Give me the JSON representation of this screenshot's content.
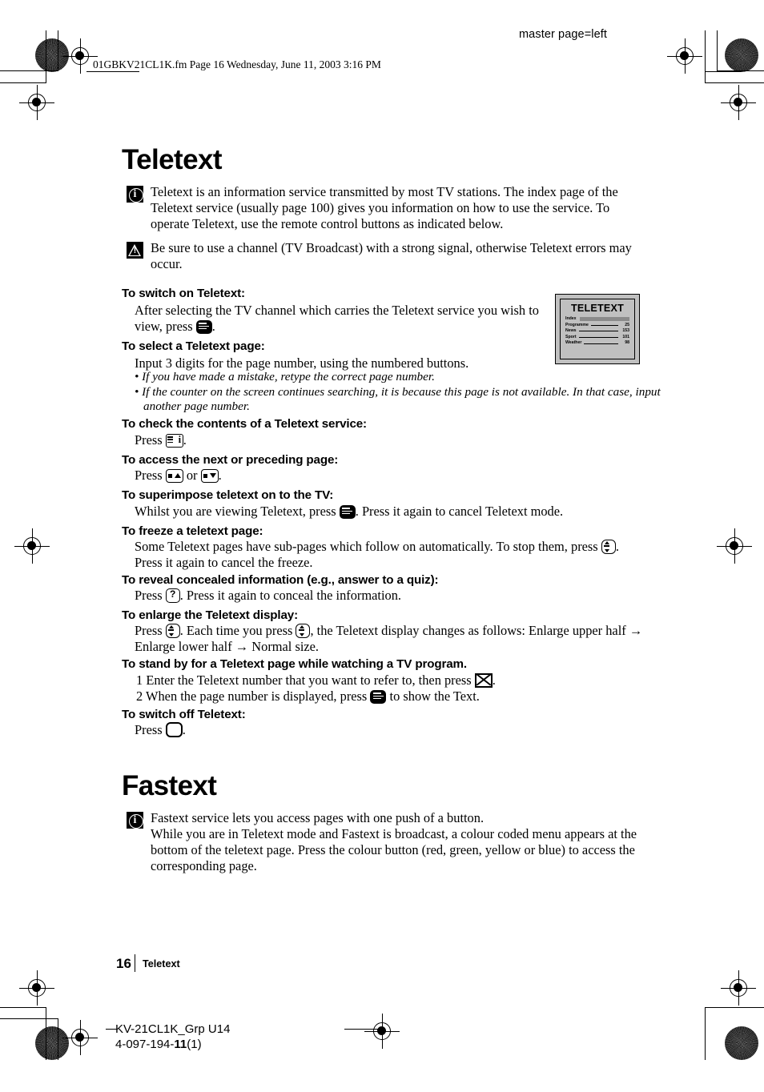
{
  "header": {
    "master_page": "master page=left",
    "filename_line": "01GBKV21CL1K.fm  Page 16  Wednesday, June 11, 2003  3:16 PM"
  },
  "teletext": {
    "title": "Teletext",
    "info_note": "Teletext is an information service transmitted by most TV stations. The index page of the Teletext service (usually page 100) gives you information on how to use the service. To operate Teletext, use the remote control buttons as indicated below.",
    "warning_note": "Be sure to use a channel (TV Broadcast) with a strong signal, otherwise Teletext errors may occur.",
    "sections": {
      "switch_on": {
        "heading": "To switch on Teletext:",
        "body_before": "After selecting the TV channel which carries the Teletext service you wish to view, press",
        "body_after": "."
      },
      "select_page": {
        "heading": "To select a Teletext page:",
        "body": "Input 3 digits for the page number, using the numbered buttons.",
        "bullet1": "If you have made a mistake, retype the correct page number.",
        "bullet2": "If the counter on the screen continues searching, it is because this page is not available. In that case, input another page number."
      },
      "check_contents": {
        "heading": "To check the contents of a Teletext service:",
        "body_before": "Press",
        "body_after": "."
      },
      "next_preceding": {
        "heading": "To access the next or preceding page:",
        "body_before": "Press",
        "body_mid": "or",
        "body_after": "."
      },
      "superimpose": {
        "heading": "To superimpose teletext on to the TV:",
        "body_before": "Whilst you are viewing Teletext, press",
        "body_after": ". Press it again to cancel Teletext mode."
      },
      "freeze": {
        "heading": "To freeze a teletext page:",
        "body_before": "Some Teletext pages have sub-pages which follow on automatically. To stop them, press",
        "body_after": ". Press it again to cancel the freeze."
      },
      "reveal": {
        "heading": "To reveal concealed information (e.g., answer to a quiz):",
        "body_before": "Press",
        "body_after": ". Press it again to conceal the information."
      },
      "enlarge": {
        "heading": "To enlarge the Teletext display:",
        "body_before": "Press",
        "body_mid": ". Each time you press",
        "body_after": ", the Teletext display changes as follows: Enlarge upper half",
        "body_line2_a": "Enlarge lower half",
        "body_line2_b": "Normal size.",
        "arrow": "→"
      },
      "standby": {
        "heading": "To stand by for a Teletext page while watching a TV program.",
        "step1_num": "1",
        "step1_before": "Enter the Teletext number that you want to refer to, then press",
        "step1_after": ".",
        "step2_num": "2",
        "step2_before": "When the page number is displayed, press",
        "step2_after": "to show the Text."
      },
      "switch_off": {
        "heading": "To switch off Teletext:",
        "body_before": "Press",
        "body_after": "."
      }
    }
  },
  "tt_screen": {
    "title": "TELETEXT",
    "rows": [
      {
        "label": "Index",
        "value": ""
      },
      {
        "label": "Programme",
        "value": "25"
      },
      {
        "label": "News",
        "value": "153"
      },
      {
        "label": "Sport",
        "value": "101"
      },
      {
        "label": "Weather",
        "value": "98"
      }
    ]
  },
  "fastext": {
    "title": "Fastext",
    "info_line1": "Fastext service lets you access pages with one push of a button.",
    "info_line2": "While you are in Teletext mode and Fastext is broadcast, a colour coded menu appears at the bottom of the teletext page. Press the colour button (red, green, yellow or blue) to access the corresponding page."
  },
  "footer": {
    "page_number": "16",
    "page_label": "Teletext",
    "model": "KV-21CL1K_Grp U14",
    "code_prefix": "4-097-194-",
    "code_bold": "11",
    "code_suffix": "(1)"
  }
}
